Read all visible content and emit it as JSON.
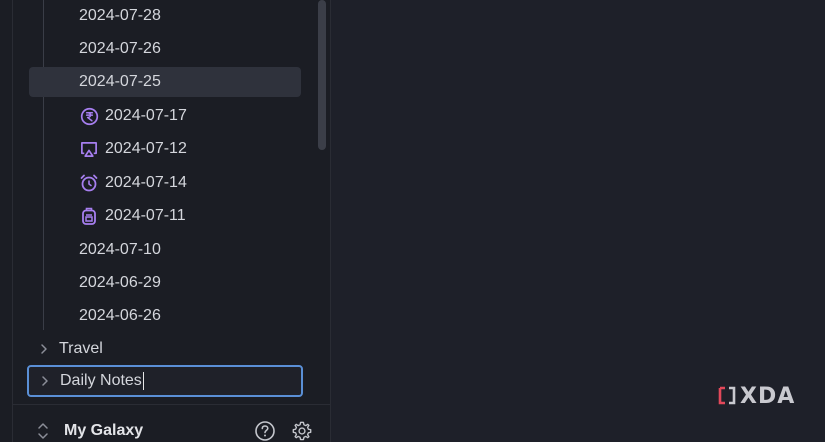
{
  "sidebar": {
    "items": [
      {
        "label": "2024-07-28",
        "icon": null,
        "selected": false
      },
      {
        "label": "2024-07-26",
        "icon": null,
        "selected": false
      },
      {
        "label": "2024-07-25",
        "icon": null,
        "selected": true
      },
      {
        "label": "2024-07-17",
        "icon": "rupee-coin-icon",
        "selected": false
      },
      {
        "label": "2024-07-12",
        "icon": "screen-cast-icon",
        "selected": false
      },
      {
        "label": "2024-07-14",
        "icon": "alarm-clock-icon",
        "selected": false
      },
      {
        "label": "2024-07-11",
        "icon": "backpack-icon",
        "selected": false
      },
      {
        "label": "2024-07-10",
        "icon": null,
        "selected": false
      },
      {
        "label": "2024-06-29",
        "icon": null,
        "selected": false
      },
      {
        "label": "2024-06-26",
        "icon": null,
        "selected": false
      }
    ],
    "folders": [
      {
        "label": "Travel",
        "renaming": false
      },
      {
        "label": "Daily Notes",
        "renaming": true
      }
    ]
  },
  "footer": {
    "vault_name": "My Galaxy",
    "help_icon": "help-circle-icon",
    "settings_icon": "gear-icon"
  },
  "watermark": {
    "text": "XDA"
  },
  "colors": {
    "background": "#1e2029",
    "sidebar": "#1b1d24",
    "selected_row": "#2f323c",
    "icon_accent": "#a77ff0",
    "rename_border": "#5a8fd6",
    "watermark_accent": "#e2485a"
  }
}
